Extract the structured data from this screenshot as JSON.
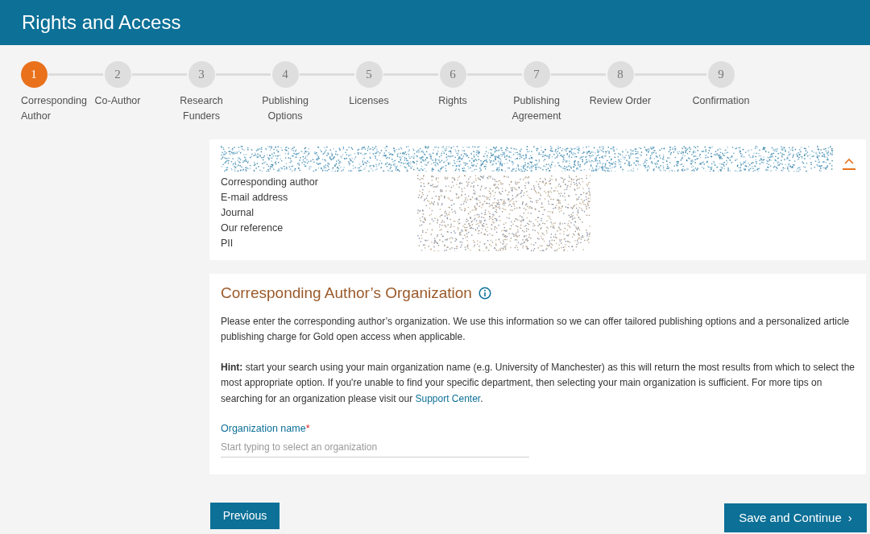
{
  "header": {
    "title": "Rights and Access"
  },
  "steps": [
    {
      "number": "1",
      "label": "Corresponding Author",
      "selected": true
    },
    {
      "number": "2",
      "label": "Co-Author",
      "selected": false
    },
    {
      "number": "3",
      "label": "Research Funders",
      "selected": false
    },
    {
      "number": "4",
      "label": "Publishing Options",
      "selected": false
    },
    {
      "number": "5",
      "label": "Licenses",
      "selected": false
    },
    {
      "number": "6",
      "label": "Rights",
      "selected": false
    },
    {
      "number": "7",
      "label": "Publishing Agreement",
      "selected": false
    },
    {
      "number": "8",
      "label": "Review Order",
      "selected": false
    },
    {
      "number": "9",
      "label": "Confirmation",
      "selected": false
    }
  ],
  "summary": {
    "expanded": true,
    "fields": [
      "Corresponding author",
      "E-mail address",
      "Journal",
      "Our reference",
      "PII"
    ]
  },
  "organization": {
    "title": "Corresponding Author’s Organization",
    "intro": "Please enter the corresponding author’s organization. We use this information so we can offer tailored publishing options and a personalized article publishing charge for Gold open access when applicable.",
    "hint": "**Hint:** start your search using your main organization name (e.g. University of Manchester) as this will return the most results from which to select the most appropriate option. If you're unable to find your specific department, then selecting your main organization is sufficient. For more tips on searching for an organization please visit our",
    "link": "Support Center",
    "after_link": ".",
    "field_label": "Organization name",
    "required_mark": "*",
    "placeholder": "Start typing to select an organization"
  },
  "buttons": {
    "previous": "Previous",
    "next": "Save and Continue",
    "next_icon": "›"
  }
}
